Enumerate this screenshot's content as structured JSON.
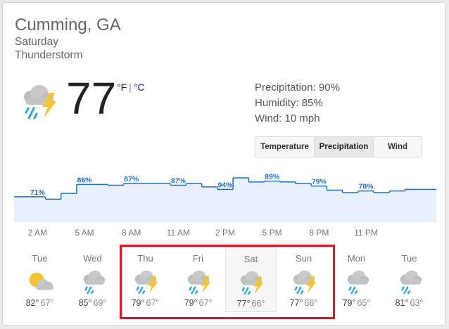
{
  "location": "Cumming, GA",
  "day": "Saturday",
  "condition": "Thunderstorm",
  "current": {
    "temp": "77",
    "unit_f": "°F",
    "unit_sep": "|",
    "unit_c": "°C",
    "icon": "thunderstorm-icon"
  },
  "stats": {
    "precipitation": "Precipitation: 90%",
    "humidity": "Humidity: 85%",
    "wind": "Wind: 10 mph"
  },
  "tabs": [
    {
      "label": "Temperature",
      "active": false
    },
    {
      "label": "Precipitation",
      "active": true
    },
    {
      "label": "Wind",
      "active": false
    }
  ],
  "colors": {
    "accent": "#1a73c9",
    "area_fill": "#e8f0fe",
    "highlight_box": "#e0161a",
    "sun": "#f4c430",
    "rain": "#29a8e0"
  },
  "chart_data": {
    "type": "area",
    "title": "",
    "ylabel": "",
    "xlabel": "",
    "ylim": [
      0,
      100
    ],
    "unit": "%",
    "x_ticks": [
      "2 AM",
      "5 AM",
      "8 AM",
      "11 AM",
      "2 PM",
      "5 PM",
      "8 PM",
      "11 PM"
    ],
    "values": [
      71,
      71,
      68,
      75,
      86,
      86,
      85,
      87,
      87,
      87,
      85,
      87,
      83,
      80,
      94,
      89,
      90,
      89,
      87,
      84,
      79,
      76,
      78,
      76,
      78,
      80,
      80
    ],
    "labels": [
      {
        "index": 1,
        "text": "71%"
      },
      {
        "index": 4,
        "text": "86%"
      },
      {
        "index": 7,
        "text": "87%"
      },
      {
        "index": 10,
        "text": "87%"
      },
      {
        "index": 13,
        "text": "94%"
      },
      {
        "index": 16,
        "text": "89%"
      },
      {
        "index": 19,
        "text": "79%"
      },
      {
        "index": 22,
        "text": "78%"
      }
    ]
  },
  "forecast": [
    {
      "day": "Tue",
      "hi": "82°",
      "lo": "67°",
      "icon": "partly-cloudy-sun-icon",
      "selected": false
    },
    {
      "day": "Wed",
      "hi": "85°",
      "lo": "69°",
      "icon": "rain-cloud-icon",
      "selected": false
    },
    {
      "day": "Thu",
      "hi": "79°",
      "lo": "67°",
      "icon": "thunderstorm-icon",
      "selected": false
    },
    {
      "day": "Fri",
      "hi": "79°",
      "lo": "67°",
      "icon": "thunderstorm-icon",
      "selected": false
    },
    {
      "day": "Sat",
      "hi": "77°",
      "lo": "66°",
      "icon": "thunderstorm-icon",
      "selected": true
    },
    {
      "day": "Sun",
      "hi": "77°",
      "lo": "66°",
      "icon": "thunderstorm-icon",
      "selected": false
    },
    {
      "day": "Mon",
      "hi": "79°",
      "lo": "65°",
      "icon": "rain-cloud-icon",
      "selected": false
    },
    {
      "day": "Tue",
      "hi": "81°",
      "lo": "63°",
      "icon": "rain-cloud-icon",
      "selected": false
    }
  ]
}
